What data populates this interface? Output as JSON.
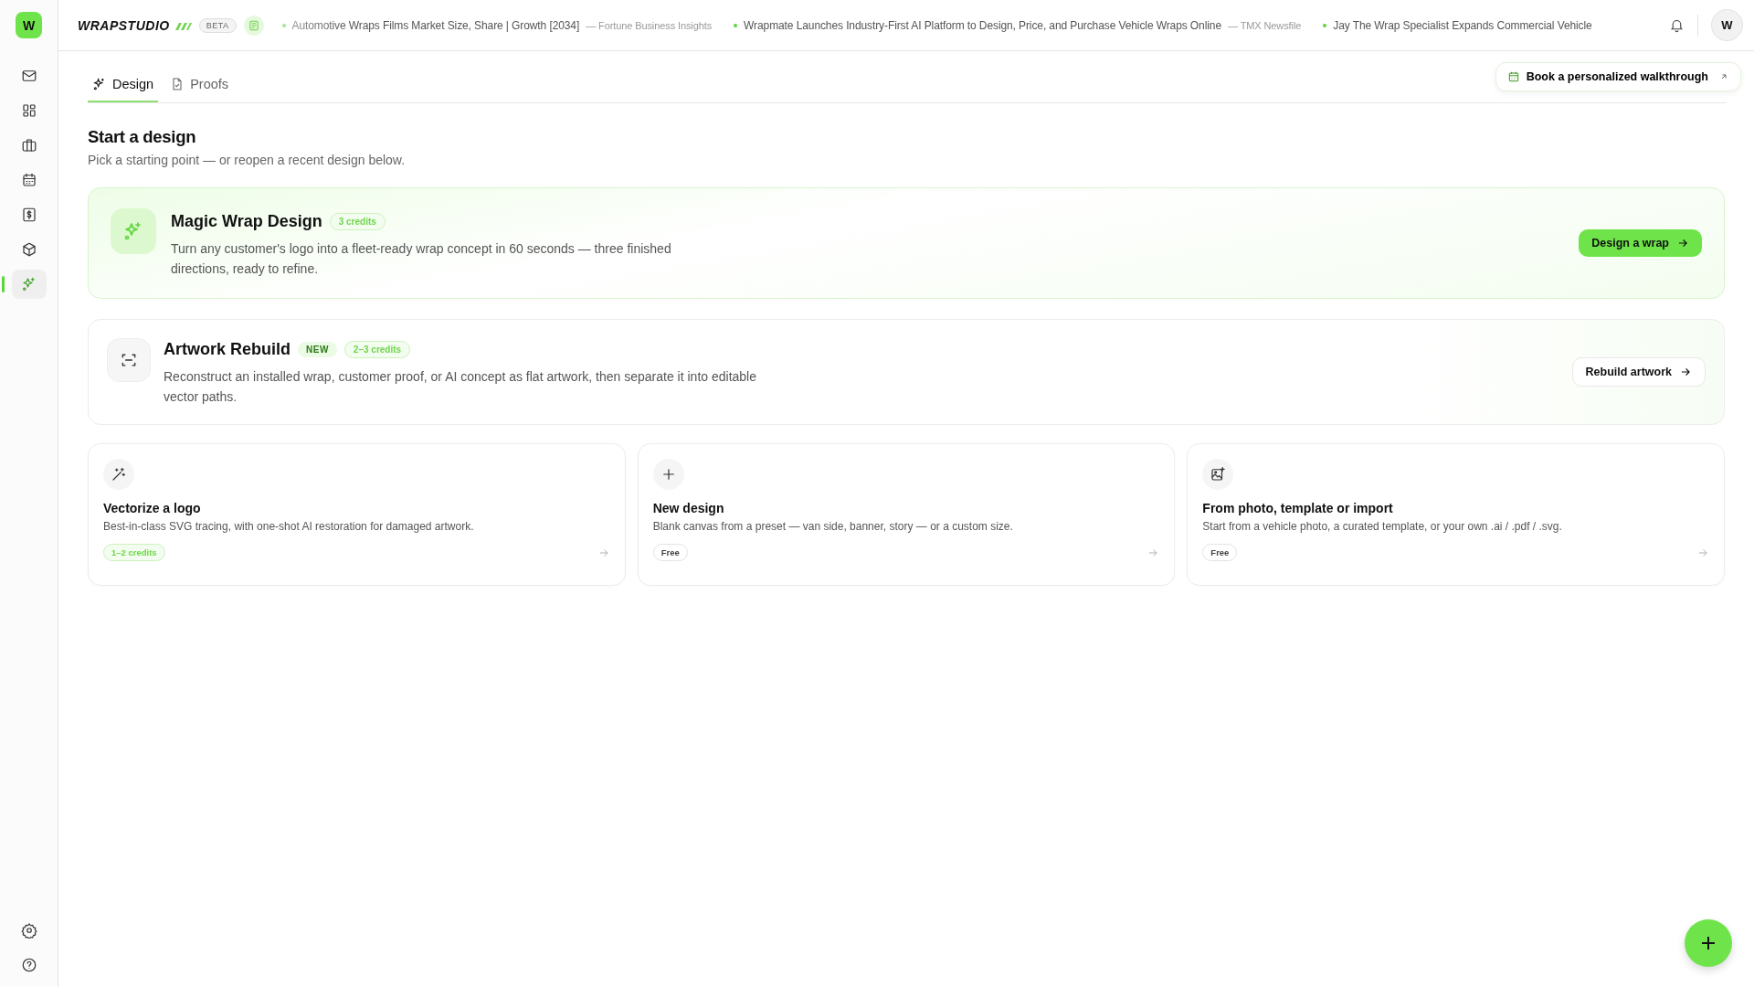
{
  "app": {
    "logo_letter": "W",
    "brand": "WRAPSTUDIO",
    "badge": "BETA"
  },
  "news": [
    {
      "title": "Automotive Wraps Films Market Size, Share | Growth [2034]",
      "source": "— Fortune Business Insights"
    },
    {
      "title": "Wrapmate Launches Industry-First AI Platform to Design, Price, and Purchase Vehicle Wraps Online",
      "source": "— TMX Newsfile"
    },
    {
      "title": "Jay The Wrap Specialist Expands Commercial Vehicle"
    }
  ],
  "user": {
    "avatar": "W"
  },
  "sidebar": {
    "items": [
      {
        "kind": "mail",
        "selected": false
      },
      {
        "kind": "grid",
        "selected": false
      },
      {
        "kind": "briefcase",
        "selected": false
      },
      {
        "kind": "calendar",
        "selected": false
      },
      {
        "kind": "dollar",
        "selected": false
      },
      {
        "kind": "box",
        "selected": false
      },
      {
        "kind": "sparkle",
        "selected": true
      }
    ],
    "bottom": [
      {
        "kind": "settings"
      },
      {
        "kind": "help"
      }
    ]
  },
  "tabs": [
    {
      "label": "Design",
      "kind": "sparkle",
      "selected": true
    },
    {
      "label": "Proofs",
      "kind": "doc",
      "selected": false
    }
  ],
  "walkthrough_button": "Book a personalized walkthrough",
  "heading": "Start a design",
  "subheading": "Pick a starting point — or reopen a recent design below.",
  "feature_cards": [
    {
      "kind": "magic",
      "title": "Magic Wrap Design",
      "tags": [
        {
          "label": "3 credits",
          "kind": "credits"
        }
      ],
      "description": "Turn any customer's logo into a fleet-ready wrap concept in 60 seconds — three finished directions, ready to refine.",
      "button": "Design a wrap"
    },
    {
      "kind": "rebuild",
      "title": "Artwork Rebuild",
      "tags": [
        {
          "label": "NEW",
          "kind": "new"
        },
        {
          "label": "2–3 credits",
          "kind": "credits"
        }
      ],
      "description": "Reconstruct an installed wrap, customer proof, or AI concept as flat artwork, then separate it into editable vector paths.",
      "button": "Rebuild artwork"
    }
  ],
  "option_cards": [
    {
      "kind": "wand",
      "title": "Vectorize a logo",
      "description": "Best-in-class SVG tracing, with one-shot AI restoration for damaged artwork.",
      "tag": {
        "label": "1–2 credits",
        "kind": "credits"
      }
    },
    {
      "kind": "plus",
      "title": "New design",
      "description": "Blank canvas from a preset — van side, banner, story — or a custom size.",
      "tag": {
        "label": "Free",
        "kind": "free"
      }
    },
    {
      "kind": "image",
      "title": "From photo, template or import",
      "description": "Start from a vehicle photo, a curated template, or your own .ai / .pdf / .svg.",
      "tag": {
        "label": "Free",
        "kind": "free"
      }
    }
  ]
}
